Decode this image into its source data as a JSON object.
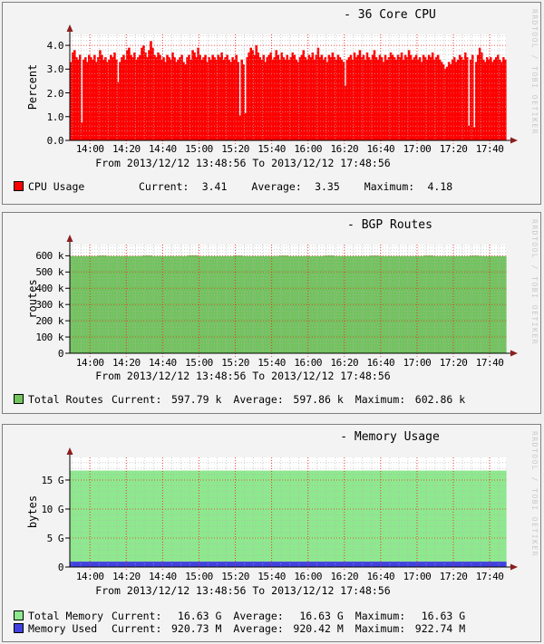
{
  "watermark": "RRDTOOL / TOBI OETIKER",
  "colors": {
    "page_bg": "#f0f0f0",
    "panel_bg": "#f3f3f3",
    "plot_bg": "#ffffff",
    "grid_minor": "#b4b4b4",
    "grid_major": "#ff0000",
    "axis": "#000000",
    "arrow": "#8b1e1e",
    "watermark_text": "#c9c9c9",
    "cpu_red": "#ff0000",
    "routes_green": "#72c35e",
    "memory_green": "#8ee88e",
    "memory_used_blue": "#4141e0"
  },
  "chart_data": [
    {
      "type": "area",
      "title": "- 36 Core CPU",
      "ylabel": "Percent",
      "footer": "From 2013/12/12 13:48:56 To 2013/12/12 17:48:56",
      "time_start": "2013/12/12 13:48:56",
      "time_end": "2013/12/12 17:48:56",
      "x": {
        "total_min": 240,
        "minor_start_min": 1.07,
        "minor_step_min": 5,
        "ticks": [
          {
            "min": 11.07,
            "label": "14:00"
          },
          {
            "min": 31.07,
            "label": "14:20"
          },
          {
            "min": 51.07,
            "label": "14:40"
          },
          {
            "min": 71.07,
            "label": "15:00"
          },
          {
            "min": 91.07,
            "label": "15:20"
          },
          {
            "min": 111.07,
            "label": "15:40"
          },
          {
            "min": 131.07,
            "label": "16:00"
          },
          {
            "min": 151.07,
            "label": "16:20"
          },
          {
            "min": 171.07,
            "label": "16:40"
          },
          {
            "min": 191.07,
            "label": "17:00"
          },
          {
            "min": 211.07,
            "label": "17:20"
          },
          {
            "min": 231.07,
            "label": "17:40"
          }
        ]
      },
      "y": {
        "max": 4.46,
        "unit": "percent",
        "minor_step": 0.2,
        "major": [
          {
            "v": 0,
            "label": "0.0"
          },
          {
            "v": 1,
            "label": "1.0"
          },
          {
            "v": 2,
            "label": "2.0"
          },
          {
            "v": 3,
            "label": "3.0"
          },
          {
            "v": 4,
            "label": "4.0"
          }
        ]
      },
      "series": [
        {
          "name": "CPU Usage",
          "color": "#ff0000",
          "values": [
            3.3,
            3.7,
            3.8,
            3.5,
            3.4,
            3.6,
            0.75,
            3.4,
            3.5,
            3.3,
            3.6,
            3.5,
            3.4,
            3.6,
            3.3,
            3.5,
            3.8,
            3.6,
            3.4,
            3.5,
            3.3,
            3.4,
            3.6,
            3.5,
            3.7,
            3.4,
            2.45,
            3.3,
            3.5,
            3.6,
            3.4,
            3.8,
            3.9,
            3.6,
            3.5,
            3.7,
            3.4,
            3.5,
            3.6,
            3.9,
            4.0,
            3.7,
            3.5,
            3.8,
            4.18,
            3.9,
            3.6,
            3.5,
            3.7,
            3.6,
            3.4,
            3.5,
            3.3,
            3.6,
            3.5,
            3.4,
            3.7,
            3.5,
            3.3,
            3.4,
            3.5,
            3.6,
            3.3,
            3.2,
            3.5,
            3.6,
            3.4,
            3.8,
            3.7,
            3.5,
            3.9,
            3.6,
            3.4,
            3.5,
            3.6,
            3.3,
            3.5,
            3.4,
            3.6,
            3.5,
            3.4,
            3.6,
            3.5,
            3.7,
            3.4,
            3.5,
            3.6,
            3.4,
            3.3,
            3.5,
            3.4,
            3.6,
            3.3,
            1.05,
            3.4,
            3.2,
            1.15,
            3.5,
            3.7,
            3.9,
            3.8,
            3.6,
            4.0,
            3.7,
            3.5,
            3.4,
            3.6,
            3.3,
            3.5,
            3.6,
            3.7,
            3.4,
            3.5,
            3.8,
            3.6,
            3.4,
            3.7,
            3.5,
            3.4,
            3.6,
            3.4,
            3.5,
            3.7,
            3.6,
            3.4,
            3.3,
            3.5,
            3.6,
            3.8,
            3.5,
            3.4,
            3.6,
            3.5,
            3.7,
            3.4,
            3.6,
            3.9,
            3.5,
            3.6,
            3.4,
            3.5,
            3.3,
            3.6,
            3.5,
            3.7,
            3.5,
            3.4,
            3.6,
            3.5,
            3.4,
            3.3,
            2.3,
            3.4,
            3.5,
            3.6,
            3.4,
            3.7,
            3.5,
            3.6,
            3.8,
            3.5,
            3.6,
            3.4,
            3.7,
            3.5,
            3.4,
            3.6,
            3.8,
            3.5,
            3.4,
            3.6,
            3.5,
            3.3,
            3.6,
            3.4,
            3.5,
            3.7,
            3.6,
            3.5,
            3.4,
            3.6,
            3.5,
            3.7,
            3.4,
            3.6,
            3.5,
            3.8,
            3.6,
            3.4,
            3.5,
            3.6,
            3.4,
            3.5,
            3.3,
            3.6,
            3.5,
            3.4,
            3.6,
            3.5,
            3.7,
            3.4,
            3.5,
            3.6,
            3.4,
            3.3,
            3.2,
            3.0,
            3.1,
            3.3,
            3.2,
            3.4,
            3.5,
            3.3,
            3.4,
            3.6,
            3.5,
            3.4,
            3.7,
            3.5,
            0.62,
            3.4,
            3.6,
            0.55,
            3.3,
            3.6,
            3.9,
            3.7,
            3.4,
            3.3,
            3.5,
            3.4,
            3.5,
            3.3,
            3.4,
            3.5,
            3.6,
            3.4,
            3.3,
            3.5,
            3.4
          ]
        }
      ],
      "legend_rows": [
        {
          "swatch": "#ff0000",
          "label": "CPU Usage",
          "stats": [
            {
              "name": "Current:",
              "value": "3.41"
            },
            {
              "name": "Average:",
              "value": "3.35"
            },
            {
              "name": "Maximum:",
              "value": "4.18"
            }
          ]
        }
      ]
    },
    {
      "type": "area",
      "title": "- BGP Routes",
      "ylabel": "routes",
      "footer": "From 2013/12/12 13:48:56 To 2013/12/12 17:48:56",
      "time_start": "2013/12/12 13:48:56",
      "time_end": "2013/12/12 17:48:56",
      "x": {
        "total_min": 240,
        "minor_start_min": 1.07,
        "minor_step_min": 5,
        "ticks": [
          {
            "min": 11.07,
            "label": "14:00"
          },
          {
            "min": 31.07,
            "label": "14:20"
          },
          {
            "min": 51.07,
            "label": "14:40"
          },
          {
            "min": 71.07,
            "label": "15:00"
          },
          {
            "min": 91.07,
            "label": "15:20"
          },
          {
            "min": 111.07,
            "label": "15:40"
          },
          {
            "min": 131.07,
            "label": "16:00"
          },
          {
            "min": 151.07,
            "label": "16:20"
          },
          {
            "min": 171.07,
            "label": "16:40"
          },
          {
            "min": 191.07,
            "label": "17:00"
          },
          {
            "min": 211.07,
            "label": "17:20"
          },
          {
            "min": 231.07,
            "label": "17:40"
          }
        ]
      },
      "y": {
        "max": 669,
        "unit": "k routes",
        "minor_step": 20,
        "major": [
          {
            "v": 0,
            "label": "0"
          },
          {
            "v": 100,
            "label": "100 k"
          },
          {
            "v": 200,
            "label": "200 k"
          },
          {
            "v": 300,
            "label": "300 k"
          },
          {
            "v": 400,
            "label": "400 k"
          },
          {
            "v": 500,
            "label": "500 k"
          },
          {
            "v": 600,
            "label": "600 k"
          }
        ]
      },
      "series": [
        {
          "name": "Total Routes",
          "color": "#72c35e",
          "values": [
            597.8,
            597.9,
            598.0,
            601.5,
            597.8,
            597.9,
            597.7,
            598.0,
            601.8,
            597.9,
            597.8,
            598.1,
            597.9,
            602.9,
            597.8,
            597.9,
            598.0,
            597.8,
            601.2,
            597.9,
            598.0,
            597.8,
            597.9,
            601.6,
            597.8,
            598.0,
            597.9,
            597.8,
            601.9,
            597.9,
            597.8,
            598.0,
            597.9,
            601.4,
            597.8,
            597.9,
            598.1,
            597.8,
            597.9,
            601.7,
            597.8,
            598.0,
            597.9,
            597.8,
            601.3,
            597.9,
            598.0,
            597.79
          ]
        }
      ],
      "legend_rows": [
        {
          "swatch": "#72c35e",
          "label": "Total Routes",
          "stats": [
            {
              "name": "Current:",
              "value": "597.79 k"
            },
            {
              "name": "Average:",
              "value": "597.86 k"
            },
            {
              "name": "Maximum:",
              "value": "602.86 k"
            }
          ]
        }
      ]
    },
    {
      "type": "area",
      "title": "- Memory Usage",
      "ylabel": "bytes",
      "footer": "From 2013/12/12 13:48:56 To 2013/12/12 17:48:56",
      "time_start": "2013/12/12 13:48:56",
      "time_end": "2013/12/12 17:48:56",
      "x": {
        "total_min": 240,
        "minor_start_min": 1.07,
        "minor_step_min": 5,
        "ticks": [
          {
            "min": 11.07,
            "label": "14:00"
          },
          {
            "min": 31.07,
            "label": "14:20"
          },
          {
            "min": 51.07,
            "label": "14:40"
          },
          {
            "min": 71.07,
            "label": "15:00"
          },
          {
            "min": 91.07,
            "label": "15:20"
          },
          {
            "min": 111.07,
            "label": "15:40"
          },
          {
            "min": 131.07,
            "label": "16:00"
          },
          {
            "min": 151.07,
            "label": "16:20"
          },
          {
            "min": 171.07,
            "label": "16:40"
          },
          {
            "min": 191.07,
            "label": "17:00"
          },
          {
            "min": 211.07,
            "label": "17:20"
          },
          {
            "min": 231.07,
            "label": "17:40"
          }
        ]
      },
      "y": {
        "max": 18.9,
        "unit": "G bytes",
        "minor_step": 1,
        "major": [
          {
            "v": 0,
            "label": "0"
          },
          {
            "v": 5,
            "label": "5 G"
          },
          {
            "v": 10,
            "label": "10 G"
          },
          {
            "v": 15,
            "label": "15 G"
          }
        ]
      },
      "series": [
        {
          "name": "Total Memory",
          "color": "#8ee88e",
          "values": [
            16.63,
            16.63
          ]
        },
        {
          "name": "Memory Used",
          "color": "#4141e0",
          "values": [
            0.92,
            0.92
          ]
        }
      ],
      "legend_rows": [
        {
          "swatch": "#8ee88e",
          "label": "Total Memory",
          "stats": [
            {
              "name": "Current:",
              "value": "16.63 G"
            },
            {
              "name": "Average:",
              "value": "16.63 G"
            },
            {
              "name": "Maximum:",
              "value": "16.63 G"
            }
          ]
        },
        {
          "swatch": "#4141e0",
          "label": "Memory Used",
          "stats": [
            {
              "name": "Current:",
              "value": "920.73 M"
            },
            {
              "name": "Average:",
              "value": "920.42 M"
            },
            {
              "name": "Maximum:",
              "value": "922.74 M"
            }
          ]
        }
      ]
    }
  ]
}
